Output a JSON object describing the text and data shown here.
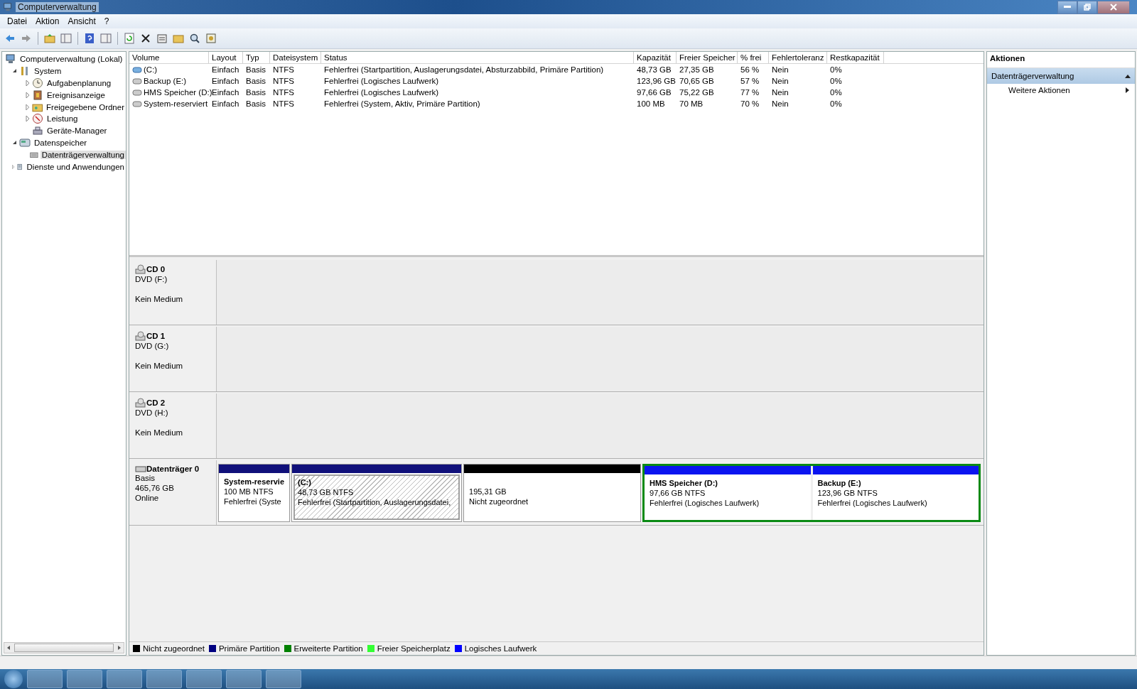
{
  "window": {
    "title": "Computerverwaltung"
  },
  "menu": [
    "Datei",
    "Aktion",
    "Ansicht",
    "?"
  ],
  "tree": [
    {
      "label": "Computerverwaltung (Lokal)",
      "children": [
        {
          "label": "System",
          "expanded": true,
          "children": [
            {
              "label": "Aufgabenplanung",
              "expanded": false
            },
            {
              "label": "Ereignisanzeige",
              "expanded": false
            },
            {
              "label": "Freigegebene Ordner",
              "expanded": false
            },
            {
              "label": "Leistung",
              "expanded": false
            },
            {
              "label": "Geräte-Manager"
            }
          ]
        },
        {
          "label": "Datenspeicher",
          "expanded": true,
          "children": [
            {
              "label": "Datenträgerverwaltung",
              "selected": true
            }
          ]
        },
        {
          "label": "Dienste und Anwendungen",
          "expanded": false
        }
      ]
    }
  ],
  "table": {
    "columns": [
      "Volume",
      "Layout",
      "Typ",
      "Dateisystem",
      "Status",
      "Kapazität",
      "Freier Speicher",
      "% frei",
      "Fehlertoleranz",
      "Restkapazität"
    ],
    "rows": [
      {
        "system": true,
        "cells": [
          "(C:)",
          "Einfach",
          "Basis",
          "NTFS",
          "Fehlerfrei (Startpartition, Auslagerungsdatei, Absturzabbild, Primäre Partition)",
          "48,73 GB",
          "27,35 GB",
          "56 %",
          "Nein",
          "0%"
        ]
      },
      {
        "system": false,
        "cells": [
          "Backup (E:)",
          "Einfach",
          "Basis",
          "NTFS",
          "Fehlerfrei (Logisches Laufwerk)",
          "123,96 GB",
          "70,65 GB",
          "57 %",
          "Nein",
          "0%"
        ]
      },
      {
        "system": false,
        "cells": [
          "HMS Speicher (D:)",
          "Einfach",
          "Basis",
          "NTFS",
          "Fehlerfrei (Logisches Laufwerk)",
          "97,66 GB",
          "75,22 GB",
          "77 %",
          "Nein",
          "0%"
        ]
      },
      {
        "system": false,
        "cells": [
          "System-reserviert",
          "Einfach",
          "Basis",
          "NTFS",
          "Fehlerfrei (System, Aktiv, Primäre Partition)",
          "100 MB",
          "70 MB",
          "70 %",
          "Nein",
          "0%"
        ]
      }
    ]
  },
  "drives": [
    {
      "kind": "cd",
      "name": "CD 0",
      "type": "DVD (F:)",
      "state": "Kein Medium"
    },
    {
      "kind": "cd",
      "name": "CD 1",
      "type": "DVD (G:)",
      "state": "Kein Medium"
    },
    {
      "kind": "cd",
      "name": "CD 2",
      "type": "DVD (H:)",
      "state": "Kein Medium"
    },
    {
      "kind": "disk",
      "name": "Datenträger 0",
      "type": "Basis",
      "size": "465,76 GB",
      "state": "Online",
      "partitions": [
        {
          "kind": "primary",
          "selected": false,
          "name": "System-reservie",
          "size": "100 MB NTFS",
          "status": "Fehlerfrei (Syste"
        },
        {
          "kind": "primary",
          "selected": true,
          "name": "(C:)",
          "size": "48,73 GB NTFS",
          "status": "Fehlerfrei (Startpartition, Auslagerungsdatei,"
        },
        {
          "kind": "unallocated",
          "selected": false,
          "size": "195,31 GB",
          "status": "Nicht zugeordnet"
        },
        {
          "kind": "extended",
          "children": [
            {
              "kind": "logical",
              "selected": false,
              "name": "HMS Speicher  (D:)",
              "size": "97,66 GB NTFS",
              "status": "Fehlerfrei (Logisches Laufwerk)"
            },
            {
              "kind": "logical",
              "selected": false,
              "name": "Backup  (E:)",
              "size": "123,96 GB NTFS",
              "status": "Fehlerfrei (Logisches Laufwerk)"
            }
          ]
        }
      ]
    }
  ],
  "legend": [
    {
      "label": "Nicht zugeordnet",
      "color": "#000000"
    },
    {
      "label": "Primäre Partition",
      "color": "#000080"
    },
    {
      "label": "Erweiterte Partition",
      "color": "#008000"
    },
    {
      "label": "Freier Speicherplatz",
      "color": "#33ff33"
    },
    {
      "label": "Logisches Laufwerk",
      "color": "#0000ff"
    }
  ],
  "actions": {
    "title": "Aktionen",
    "section": "Datenträgerverwaltung",
    "items": [
      "Weitere Aktionen"
    ]
  }
}
